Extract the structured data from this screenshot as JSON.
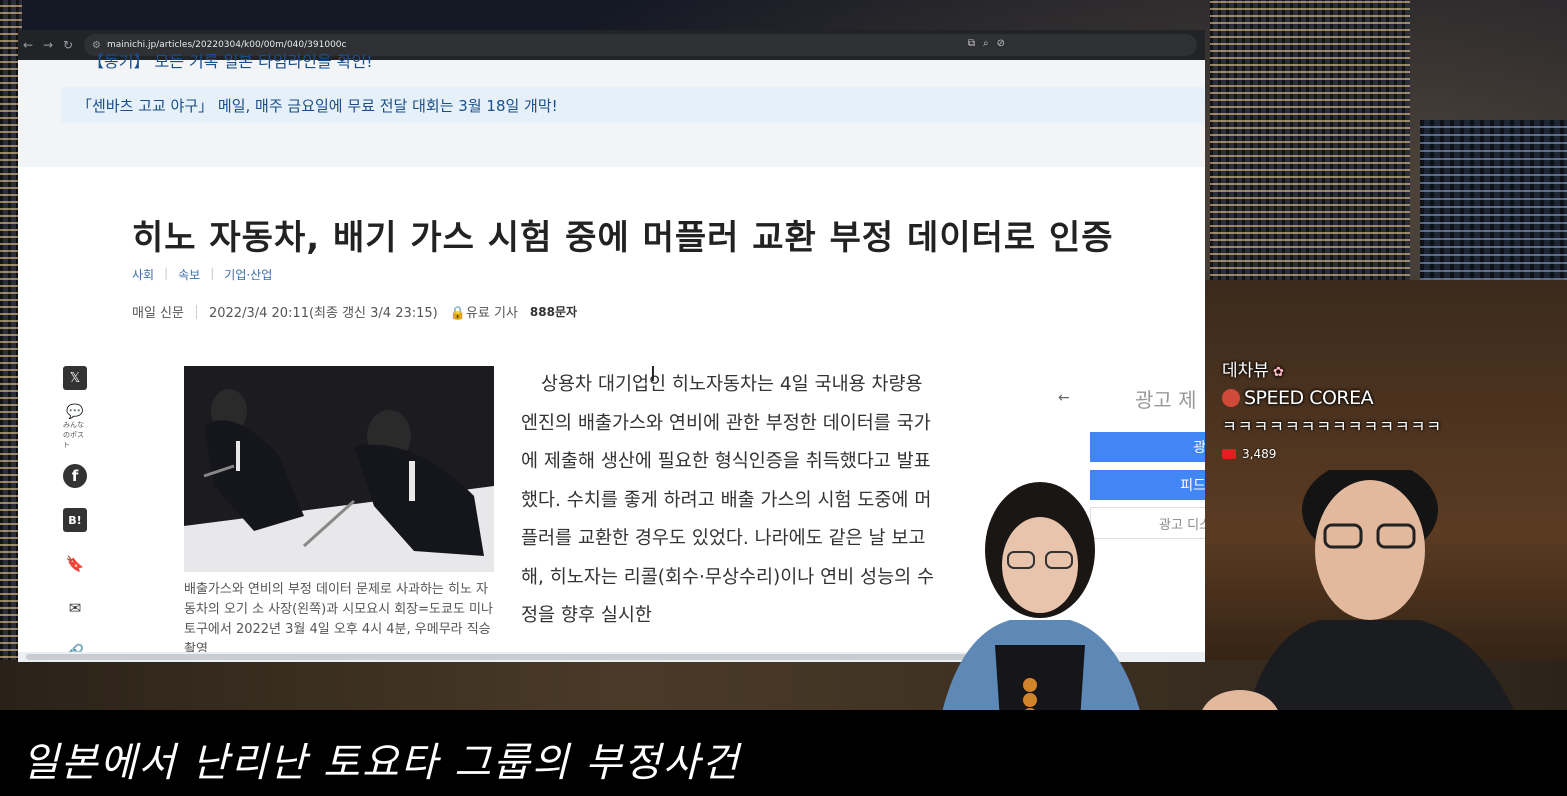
{
  "browser": {
    "url": "mainichi.jp/articles/20220304/k00/00m/040/391000c",
    "nav_icons": [
      "back-arrow",
      "forward-arrow",
      "reload"
    ]
  },
  "notices": {
    "partial_top": "【동기】 모든 기록 일본 타임라인을 확인!",
    "banner": "「센바츠 고교 야구」 메일, 매주 금요일에 무료 전달 대회는 3월 18일 개막!"
  },
  "article": {
    "headline": "히노 자동차, 배기 가스 시험 중에 머플러 교환 부정 데이터로 인증",
    "categories": [
      "사회",
      "속보",
      "기업·산업"
    ],
    "source": "매일 신문",
    "date": "2022/3/4 20:11(최종 갱신 3/4 23:15)",
    "paywall": "유료 기사",
    "char_count": "888문자",
    "caption": "배출가스와 연비의 부정 데이터 문제로 사과하는 히노 자동차의 오기 소 사장(왼쪽)과 시모요시 회장=도쿄도 미나토구에서 2022년 3월 4일 오후 4시 4분, 우메무라 직승 촬영",
    "body": "상용차 대기업인 히노자동차는 4일 국내용 차량용 엔진의 배출가스와 연비에 관한 부정한 데이터를 국가에 제출해 생산에 필요한 형식인증을 취득했다고 발표했다. 수치를 좋게 하려고 배출 가스의 시험 도중에 머플러를 교환한 경우도 있었다. 나라에도 같은 날 보고해, 히노자는 리콜(회수·무상수리)이나 연비 성능의 수정을 향후 실시한"
  },
  "share": {
    "post_label": "みんなのポスト",
    "hatena": "B!"
  },
  "ad": {
    "title": "광고 제",
    "btn1": "광",
    "btn2": "피드",
    "btn3": "광고 디스"
  },
  "stream": {
    "username": "데차뷰",
    "channel": "SPEED COREA",
    "message": "ㅋㅋㅋㅋㅋㅋㅋㅋㅋㅋㅋㅋㅋㅋ",
    "viewers": "3,489"
  },
  "subtitle": "일본에서 난리난 토요타 그룹의 부정사건",
  "colors": {
    "link": "#3b6ea8",
    "ad_button": "#4285f4",
    "notice_bg": "#e6f0f8"
  }
}
